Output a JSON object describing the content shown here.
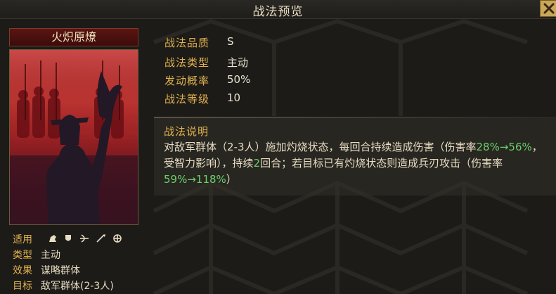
{
  "header": {
    "title": "战法预览"
  },
  "skill": {
    "name": "火炽原燎",
    "attributes": [
      {
        "label": "战法品质",
        "value": "S"
      },
      {
        "label": "战法类型",
        "value": "主动"
      },
      {
        "label": "发动概率",
        "value": "50%"
      },
      {
        "label": "战法等级",
        "value": "10"
      }
    ],
    "description": {
      "title": "战法说明",
      "part1": "对敌军群体（2-3人）施加灼烧状态，每回合持续造成伤害（伤害率",
      "rate1": "28%→56%",
      "part2": "，受智力影响），持续",
      "duration": "2",
      "part3": "回合；若目标已有灼烧状态则造成兵刃攻击（伤害率",
      "rate2": "59%→118%",
      "part4": "）"
    }
  },
  "info": {
    "applicable_label": "适用",
    "type_label": "类型",
    "type_value": "主动",
    "effect_label": "效果",
    "effect_value": "谋略群体",
    "target_label": "目标",
    "target_value": "敌军群体(2-3人)",
    "troop_icons": [
      "cavalry-icon",
      "shield-icon",
      "bow-icon",
      "spear-icon",
      "siege-icon"
    ]
  },
  "colors": {
    "gold_label": "#e1b14f",
    "green_value": "#6cd06a",
    "close_bg": "#c9a75a",
    "card_red": "#c8322f"
  }
}
